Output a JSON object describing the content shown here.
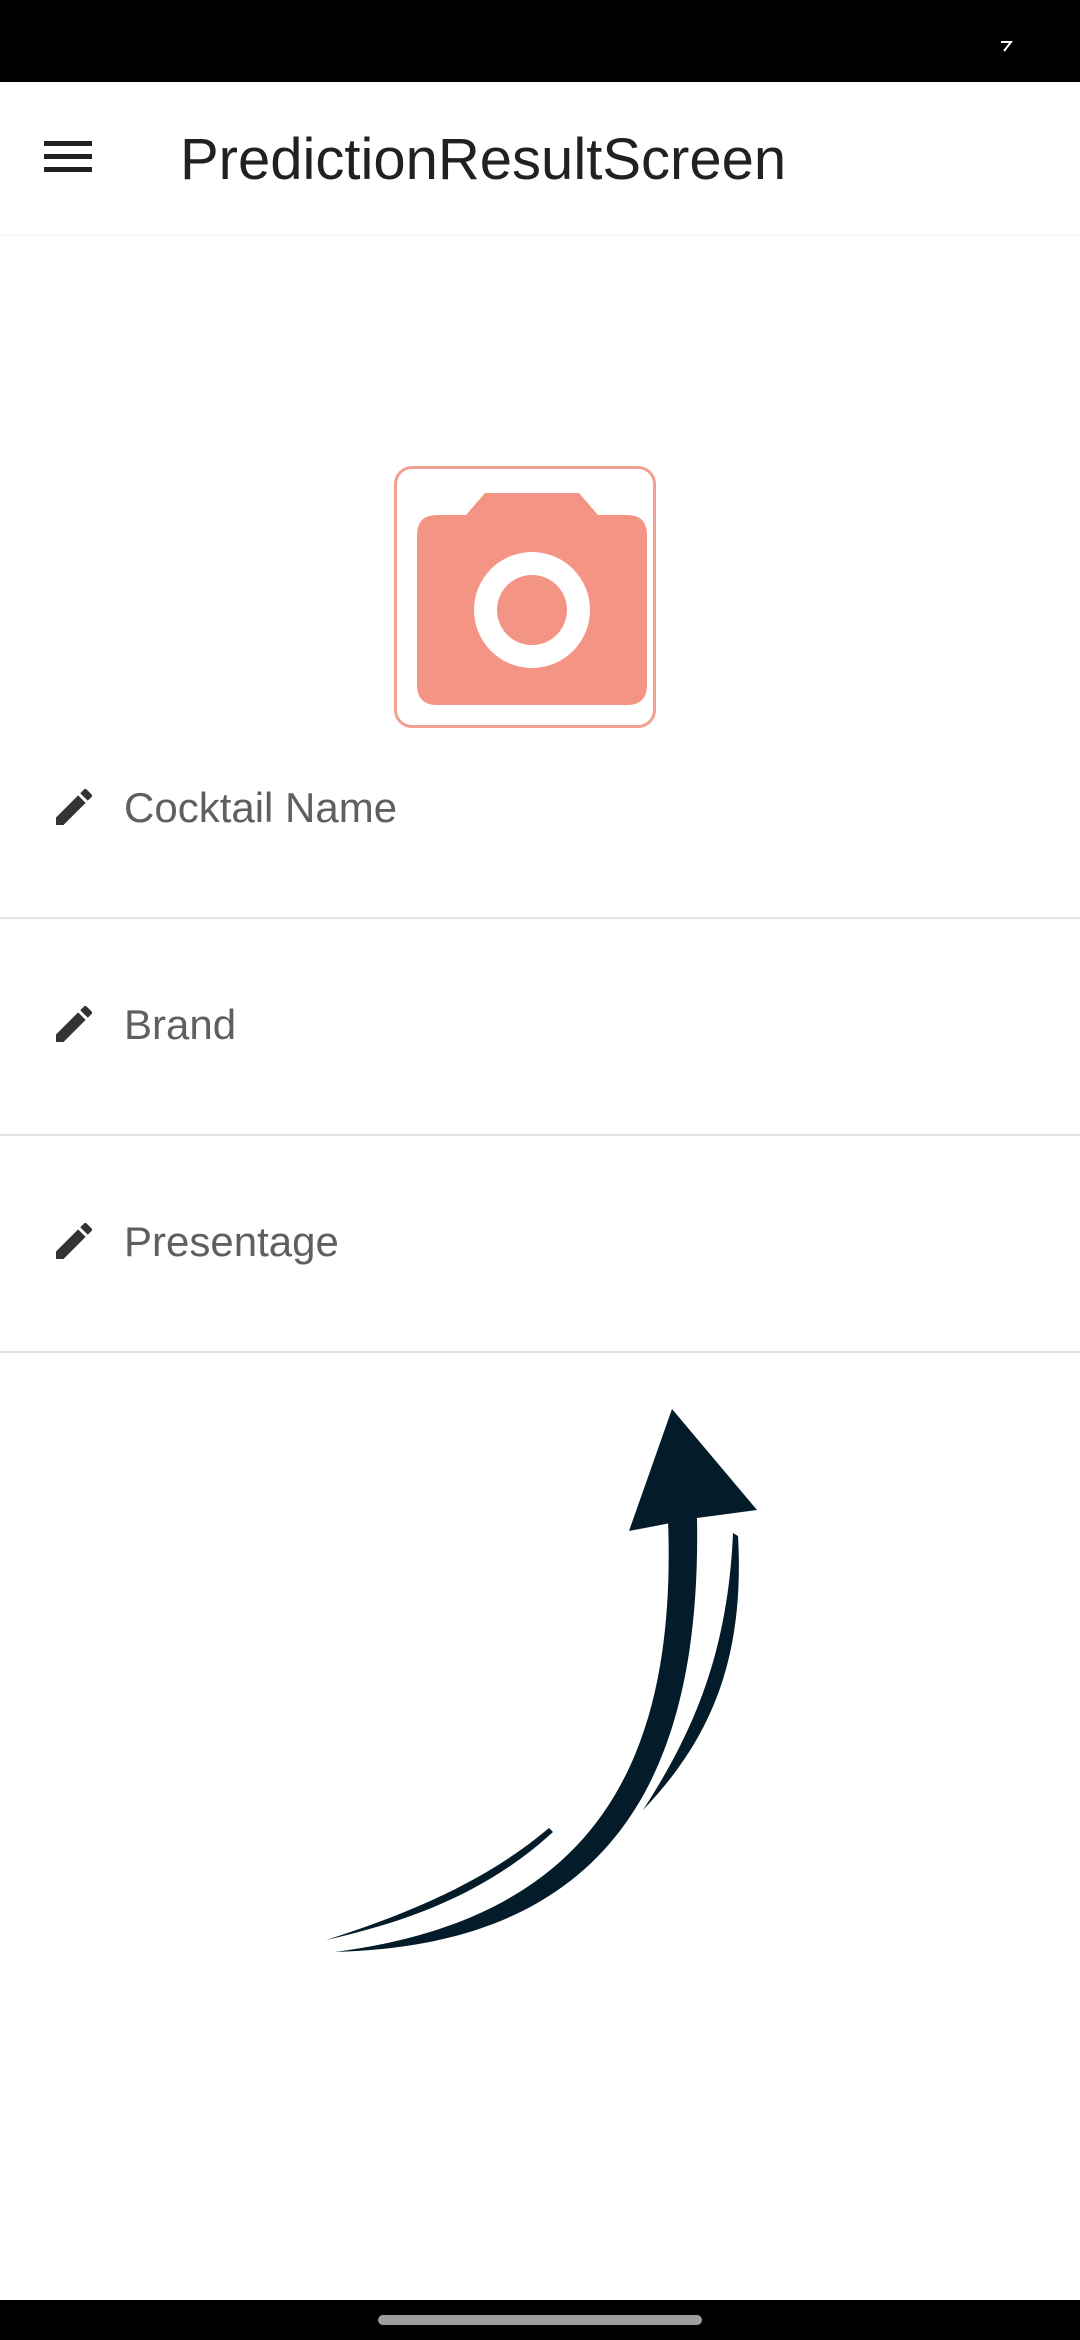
{
  "app_bar": {
    "title": "PredictionResultScreen",
    "menu_icon": "hamburger-menu-icon"
  },
  "photo_picker": {
    "icon": "camera-icon",
    "accent_color": "#f49484",
    "border_color": "#f2a090"
  },
  "form": {
    "fields": [
      {
        "icon": "pencil-icon",
        "placeholder": "Cocktail Name"
      },
      {
        "icon": "pencil-icon",
        "placeholder": "Brand"
      },
      {
        "icon": "pencil-icon",
        "placeholder": "Presentage"
      }
    ]
  },
  "hint_graphic": {
    "icon": "curved-arrow-up-icon",
    "color": "#041c2a"
  }
}
